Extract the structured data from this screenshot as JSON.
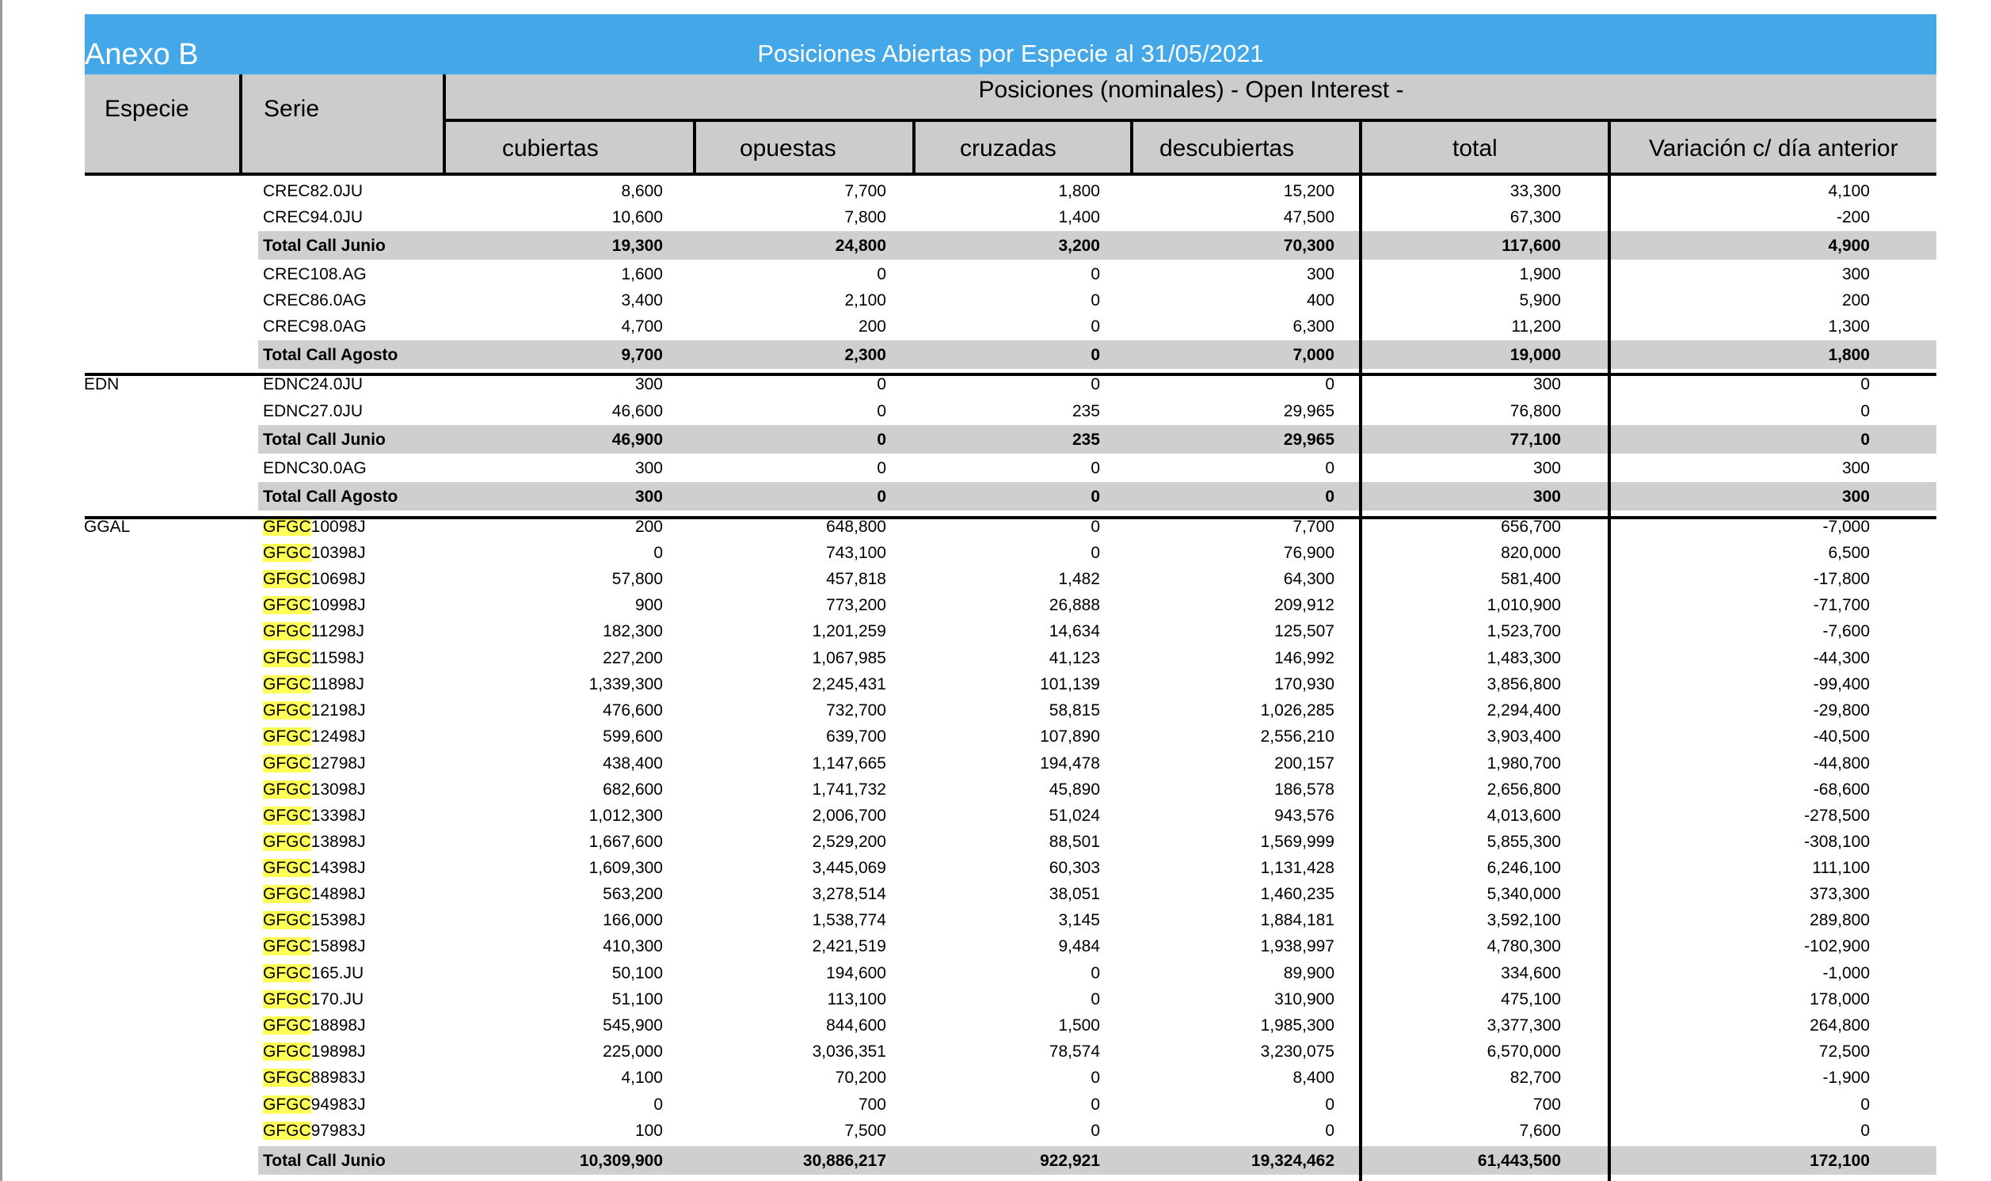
{
  "annex_label": "Anexo B",
  "title": "Posiciones Abiertas por Especie al 31/05/2021",
  "header": {
    "especie": "Especie",
    "serie": "Serie",
    "group": "Posiciones (nominales) - Open Interest -",
    "columns": [
      "cubiertas",
      "opuestas",
      "cruzadas",
      "descubiertas",
      "total",
      "Variación c/ día anterior"
    ]
  },
  "colors": {
    "title_bar": "#44a8e8",
    "header_bg": "#cccccc",
    "total_bg": "#cfcfcf",
    "highlight": "#ffff55"
  },
  "rows": [
    {
      "especie": "",
      "serie": "CREC82.0JU",
      "values": [
        "8,600",
        "7,700",
        "1,800",
        "15,200",
        "33,300",
        "4,100"
      ]
    },
    {
      "especie": "",
      "serie": "CREC94.0JU",
      "values": [
        "10,600",
        "7,800",
        "1,400",
        "47,500",
        "67,300",
        "-200"
      ]
    },
    {
      "especie": "",
      "serie": "Total Call Junio",
      "total": true,
      "values": [
        "19,300",
        "24,800",
        "3,200",
        "70,300",
        "117,600",
        "4,900"
      ]
    },
    {
      "especie": "",
      "serie": "CREC108.AG",
      "values": [
        "1,600",
        "0",
        "0",
        "300",
        "1,900",
        "300"
      ]
    },
    {
      "especie": "",
      "serie": "CREC86.0AG",
      "values": [
        "3,400",
        "2,100",
        "0",
        "400",
        "5,900",
        "200"
      ]
    },
    {
      "especie": "",
      "serie": "CREC98.0AG",
      "values": [
        "4,700",
        "200",
        "0",
        "6,300",
        "11,200",
        "1,300"
      ]
    },
    {
      "especie": "",
      "serie": "Total Call Agosto",
      "total": true,
      "values": [
        "9,700",
        "2,300",
        "0",
        "7,000",
        "19,000",
        "1,800"
      ]
    },
    {
      "especie": "EDN",
      "serie": "EDNC24.0JU",
      "values": [
        "300",
        "0",
        "0",
        "0",
        "300",
        "0"
      ]
    },
    {
      "especie": "",
      "serie": "EDNC27.0JU",
      "values": [
        "46,600",
        "0",
        "235",
        "29,965",
        "76,800",
        "0"
      ]
    },
    {
      "especie": "",
      "serie": "Total Call Junio",
      "total": true,
      "values": [
        "46,900",
        "0",
        "235",
        "29,965",
        "77,100",
        "0"
      ]
    },
    {
      "especie": "",
      "serie": "EDNC30.0AG",
      "values": [
        "300",
        "0",
        "0",
        "0",
        "300",
        "300"
      ]
    },
    {
      "especie": "",
      "serie": "Total Call Agosto",
      "total": true,
      "values": [
        "300",
        "0",
        "0",
        "0",
        "300",
        "300"
      ]
    },
    {
      "especie": "GGAL",
      "serie_prefix": "GFGC",
      "serie": "10098J",
      "values": [
        "200",
        "648,800",
        "0",
        "7,700",
        "656,700",
        "-7,000"
      ]
    },
    {
      "especie": "",
      "serie_prefix": "GFGC",
      "serie": "10398J",
      "values": [
        "0",
        "743,100",
        "0",
        "76,900",
        "820,000",
        "6,500"
      ]
    },
    {
      "especie": "",
      "serie_prefix": "GFGC",
      "serie": "10698J",
      "values": [
        "57,800",
        "457,818",
        "1,482",
        "64,300",
        "581,400",
        "-17,800"
      ]
    },
    {
      "especie": "",
      "serie_prefix": "GFGC",
      "serie": "10998J",
      "values": [
        "900",
        "773,200",
        "26,888",
        "209,912",
        "1,010,900",
        "-71,700"
      ]
    },
    {
      "especie": "",
      "serie_prefix": "GFGC",
      "serie": "11298J",
      "values": [
        "182,300",
        "1,201,259",
        "14,634",
        "125,507",
        "1,523,700",
        "-7,600"
      ]
    },
    {
      "especie": "",
      "serie_prefix": "GFGC",
      "serie": "11598J",
      "values": [
        "227,200",
        "1,067,985",
        "41,123",
        "146,992",
        "1,483,300",
        "-44,300"
      ]
    },
    {
      "especie": "",
      "serie_prefix": "GFGC",
      "serie": "11898J",
      "values": [
        "1,339,300",
        "2,245,431",
        "101,139",
        "170,930",
        "3,856,800",
        "-99,400"
      ]
    },
    {
      "especie": "",
      "serie_prefix": "GFGC",
      "serie": "12198J",
      "values": [
        "476,600",
        "732,700",
        "58,815",
        "1,026,285",
        "2,294,400",
        "-29,800"
      ]
    },
    {
      "especie": "",
      "serie_prefix": "GFGC",
      "serie": "12498J",
      "values": [
        "599,600",
        "639,700",
        "107,890",
        "2,556,210",
        "3,903,400",
        "-40,500"
      ]
    },
    {
      "especie": "",
      "serie_prefix": "GFGC",
      "serie": "12798J",
      "values": [
        "438,400",
        "1,147,665",
        "194,478",
        "200,157",
        "1,980,700",
        "-44,800"
      ]
    },
    {
      "especie": "",
      "serie_prefix": "GFGC",
      "serie": "13098J",
      "values": [
        "682,600",
        "1,741,732",
        "45,890",
        "186,578",
        "2,656,800",
        "-68,600"
      ]
    },
    {
      "especie": "",
      "serie_prefix": "GFGC",
      "serie": "13398J",
      "values": [
        "1,012,300",
        "2,006,700",
        "51,024",
        "943,576",
        "4,013,600",
        "-278,500"
      ]
    },
    {
      "especie": "",
      "serie_prefix": "GFGC",
      "serie": "13898J",
      "values": [
        "1,667,600",
        "2,529,200",
        "88,501",
        "1,569,999",
        "5,855,300",
        "-308,100"
      ]
    },
    {
      "especie": "",
      "serie_prefix": "GFGC",
      "serie": "14398J",
      "values": [
        "1,609,300",
        "3,445,069",
        "60,303",
        "1,131,428",
        "6,246,100",
        "111,100"
      ]
    },
    {
      "especie": "",
      "serie_prefix": "GFGC",
      "serie": "14898J",
      "values": [
        "563,200",
        "3,278,514",
        "38,051",
        "1,460,235",
        "5,340,000",
        "373,300"
      ]
    },
    {
      "especie": "",
      "serie_prefix": "GFGC",
      "serie": "15398J",
      "values": [
        "166,000",
        "1,538,774",
        "3,145",
        "1,884,181",
        "3,592,100",
        "289,800"
      ]
    },
    {
      "especie": "",
      "serie_prefix": "GFGC",
      "serie": "15898J",
      "values": [
        "410,300",
        "2,421,519",
        "9,484",
        "1,938,997",
        "4,780,300",
        "-102,900"
      ]
    },
    {
      "especie": "",
      "serie_prefix": "GFGC",
      "serie": "165.JU",
      "values": [
        "50,100",
        "194,600",
        "0",
        "89,900",
        "334,600",
        "-1,000"
      ]
    },
    {
      "especie": "",
      "serie_prefix": "GFGC",
      "serie": "170.JU",
      "values": [
        "51,100",
        "113,100",
        "0",
        "310,900",
        "475,100",
        "178,000"
      ]
    },
    {
      "especie": "",
      "serie_prefix": "GFGC",
      "serie": "18898J",
      "values": [
        "545,900",
        "844,600",
        "1,500",
        "1,985,300",
        "3,377,300",
        "264,800"
      ]
    },
    {
      "especie": "",
      "serie_prefix": "GFGC",
      "serie": "19898J",
      "values": [
        "225,000",
        "3,036,351",
        "78,574",
        "3,230,075",
        "6,570,000",
        "72,500"
      ]
    },
    {
      "especie": "",
      "serie_prefix": "GFGC",
      "serie": "88983J",
      "values": [
        "4,100",
        "70,200",
        "0",
        "8,400",
        "82,700",
        "-1,900"
      ]
    },
    {
      "especie": "",
      "serie_prefix": "GFGC",
      "serie": "94983J",
      "values": [
        "0",
        "700",
        "0",
        "0",
        "700",
        "0"
      ]
    },
    {
      "especie": "",
      "serie_prefix": "GFGC",
      "serie": "97983J",
      "values": [
        "100",
        "7,500",
        "0",
        "0",
        "7,600",
        "0"
      ]
    },
    {
      "especie": "",
      "serie": "Total Call Junio",
      "total": true,
      "values": [
        "10,309,900",
        "30,886,217",
        "922,921",
        "19,324,462",
        "61,443,500",
        "172,100"
      ]
    }
  ]
}
